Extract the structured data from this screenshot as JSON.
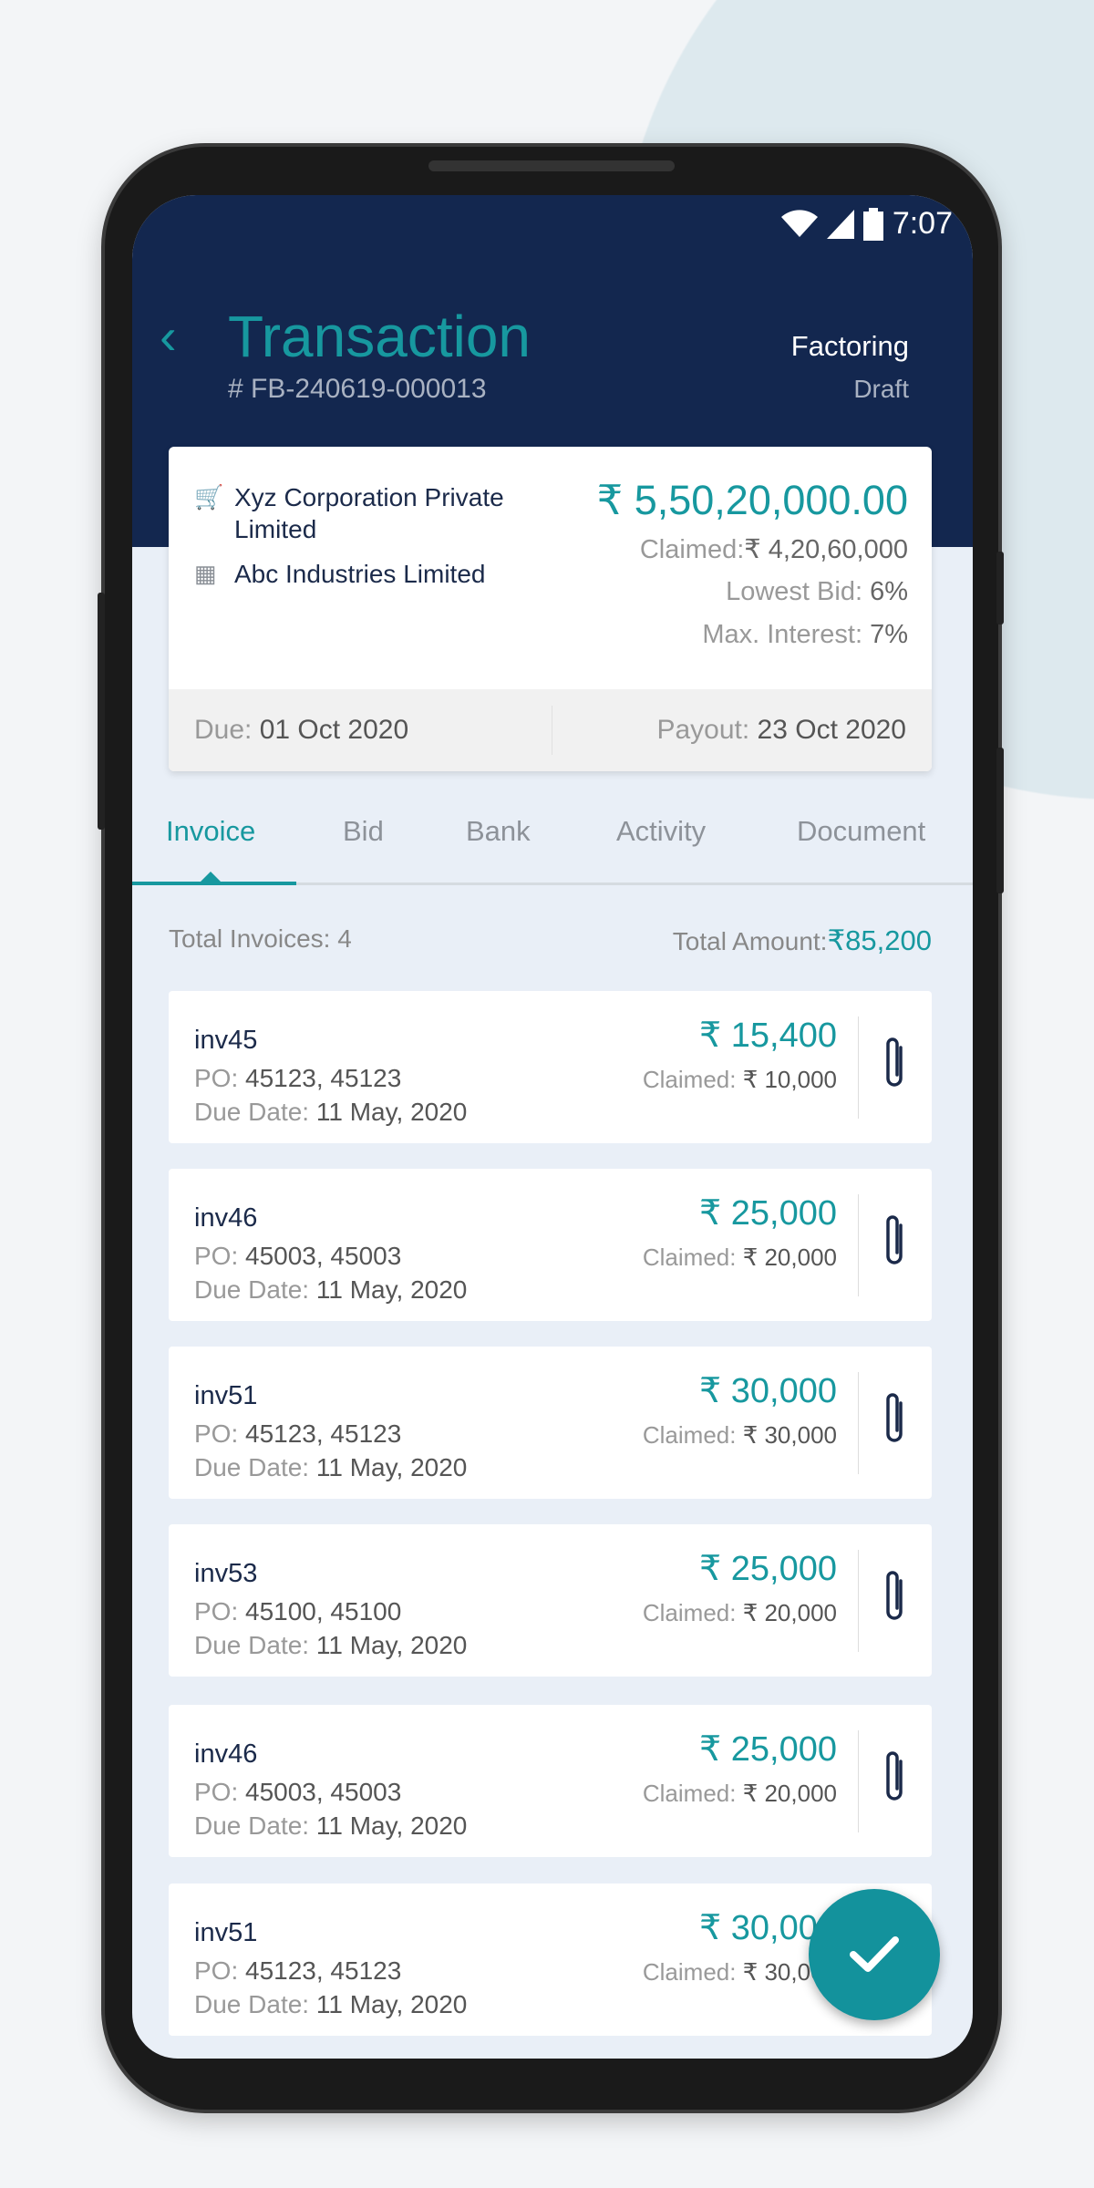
{
  "status_bar": {
    "time": "7:07",
    "icons": [
      "wifi-icon",
      "signal-icon",
      "battery-icon"
    ]
  },
  "header": {
    "title": "Transaction",
    "transaction_id": "# FB-240619-000013",
    "type": "Factoring",
    "status": "Draft",
    "back_icon": "chevron-left-icon"
  },
  "summary": {
    "buyer": "Xyz Corporation Private Limited",
    "buyer_icon": "basket-icon",
    "seller": "Abc Industries Limited",
    "seller_icon": "cash-register-icon",
    "amount": "₹ 5,50,20,000.00",
    "claimed_label": "Claimed:",
    "claimed_value": "₹ 4,20,60,000",
    "lowest_bid_label": "Lowest Bid:",
    "lowest_bid_value": "6%",
    "max_interest_label": "Max. Interest:",
    "max_interest_value": "7%",
    "due_label": "Due:",
    "due_value": "01 Oct 2020",
    "payout_label": "Payout:",
    "payout_value": "23 Oct 2020"
  },
  "tabs": [
    {
      "label": "Invoice",
      "active": true
    },
    {
      "label": "Bid"
    },
    {
      "label": "Bank"
    },
    {
      "label": "Activity"
    },
    {
      "label": "Document"
    }
  ],
  "totals": {
    "invoices_label": "Total Invoices: 4",
    "amount_label": "Total Amount:",
    "amount_value": "₹85,200"
  },
  "labels": {
    "po": "PO:",
    "due_date": "Due Date:",
    "claimed": "Claimed:"
  },
  "invoices": [
    {
      "name": "inv45",
      "po": "45123, 45123",
      "due": "11 May, 2020",
      "amount": "₹ 15,400",
      "claimed": "₹ 10,000"
    },
    {
      "name": "inv46",
      "po": "45003, 45003",
      "due": "11 May, 2020",
      "amount": "₹ 25,000",
      "claimed": "₹ 20,000"
    },
    {
      "name": "inv51",
      "po": "45123, 45123",
      "due": "11 May, 2020",
      "amount": "₹ 30,000",
      "claimed": "₹ 30,000"
    },
    {
      "name": "inv53",
      "po": "45100, 45100",
      "due": "11 May, 2020",
      "amount": "₹ 25,000",
      "claimed": "₹ 20,000"
    },
    {
      "name": "inv46",
      "po": "45003, 45003",
      "due": "11 May, 2020",
      "amount": "₹ 25,000",
      "claimed": "₹ 20,000"
    },
    {
      "name": "inv51",
      "po": "45123, 45123",
      "due": "11 May, 2020",
      "amount": "₹ 30,000",
      "claimed": "₹ 30,000"
    }
  ],
  "fab_icon": "checkmark-icon",
  "colors": {
    "navy": "#13274f",
    "teal": "#17989f",
    "background": "#e9eff7"
  }
}
